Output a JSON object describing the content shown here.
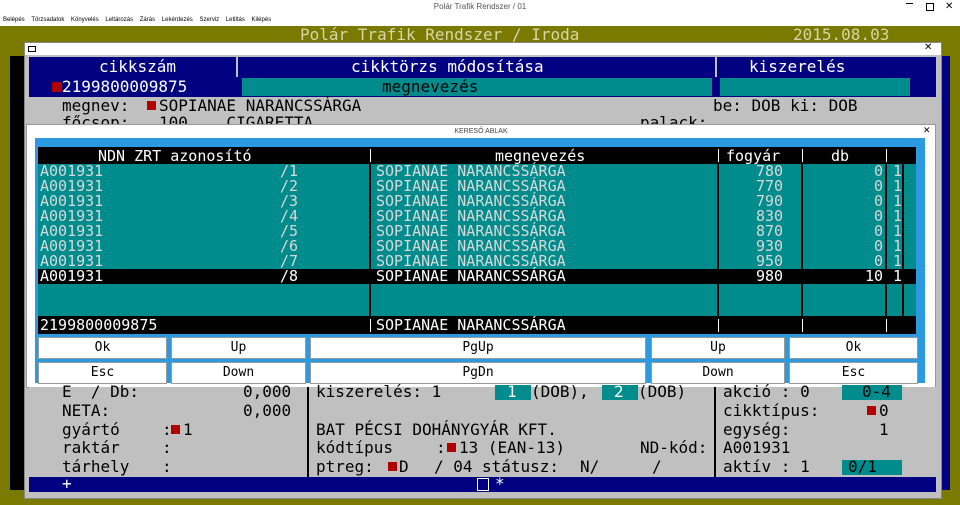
{
  "app": {
    "window_title": "Polár Trafik Rendszer / 01",
    "menu": [
      "Belépés",
      "Törzsadatok",
      "Könyvelés",
      "Leltározás",
      "Zárás",
      "Lekérdezés",
      "Szerviz",
      "Letiltás",
      "Kilépés"
    ],
    "header_title": "Polár Trafik Rendszer / Iroda",
    "date": "2015.08.03"
  },
  "form": {
    "col_cikkszam": "cikkszám",
    "col_title": "cikktörzs módosítása",
    "col_kiszereles": "kiszerelés",
    "barcode": "2199800009875",
    "megnevezes_label": "megnevezés",
    "megnev_label": "megnev:",
    "megnev_value": "SOPIANAE NARANCSSÁRGA",
    "be_ki": "be: DOB ki: DOB",
    "focsop_label": "főcsop:",
    "focsop_value": "100    CIGARETTA",
    "palack_label": "palack:",
    "e_db_label": "E  / Db:",
    "e_db_value": "0,000",
    "neta_label": "NETA:",
    "neta_value": "0,000",
    "gyarto_label": "gyártó",
    "gyarto_value": "1",
    "raktar_label": "raktár",
    "tarhely_label": "tárhely",
    "kiszereles_row": "kiszerelés: 1",
    "kisz_1": "1",
    "kisz_1_unit": "(DOB),",
    "kisz_2": "2",
    "kisz_2_unit": "(DOB)",
    "company": "BAT PÉCSI DOHÁNYGYÁR KFT.",
    "kodtipus_label": "kódtípus",
    "kodtipus_value": "13 (EAN-13)",
    "nd_kod_label": "ND-kód:",
    "nd_kod_value": "A001931",
    "ptreg_label": "ptreg:",
    "ptreg_value": "D",
    "ptreg_num": "/ 04",
    "statusz_label": "státusz:",
    "statusz_value": "N/",
    "statusz_slash": "/",
    "akcio_label": "akció : 0",
    "akcio_range": "0-4",
    "cikktipus_label": "cikktípus:",
    "cikktipus_value": "0",
    "egyseg_label": "egység:",
    "egyseg_value": "1",
    "aktiv_label": "aktív : 1",
    "aktiv_range": "0/1",
    "bottom_plus": "+",
    "bottom_star": "*"
  },
  "dialog": {
    "title": "KERESŐ ABLAK",
    "columns": [
      "NDN ZRT azonosító",
      "megnevezés",
      "fogyár",
      "db"
    ],
    "rows": [
      {
        "id": "A001931",
        "sub": "/1",
        "name": "SOPIANAE NARANCSSÁRGA",
        "price": "780",
        "db": "0",
        "x": "1"
      },
      {
        "id": "A001931",
        "sub": "/2",
        "name": "SOPIANAE NARANCSSÁRGA",
        "price": "770",
        "db": "0",
        "x": "1"
      },
      {
        "id": "A001931",
        "sub": "/3",
        "name": "SOPIANAE NARANCSSÁRGA",
        "price": "790",
        "db": "0",
        "x": "1"
      },
      {
        "id": "A001931",
        "sub": "/4",
        "name": "SOPIANAE NARANCSSÁRGA",
        "price": "830",
        "db": "0",
        "x": "1"
      },
      {
        "id": "A001931",
        "sub": "/5",
        "name": "SOPIANAE NARANCSSÁRGA",
        "price": "870",
        "db": "0",
        "x": "1"
      },
      {
        "id": "A001931",
        "sub": "/6",
        "name": "SOPIANAE NARANCSSÁRGA",
        "price": "930",
        "db": "0",
        "x": "1"
      },
      {
        "id": "A001931",
        "sub": "/7",
        "name": "SOPIANAE NARANCSSÁRGA",
        "price": "950",
        "db": "0",
        "x": "1"
      },
      {
        "id": "A001931",
        "sub": "/8",
        "name": "SOPIANAE NARANCSSÁRGA",
        "price": "980",
        "db": "10",
        "x": "1"
      }
    ],
    "footer_code": "2199800009875",
    "footer_name": "SOPIANAE NARANCSSÁRGA",
    "buttons_top": [
      "Ok",
      "Up",
      "PgUp",
      "Up",
      "Ok"
    ],
    "buttons_bottom": [
      "Esc",
      "Down",
      "PgDn",
      "Down",
      "Esc"
    ]
  }
}
